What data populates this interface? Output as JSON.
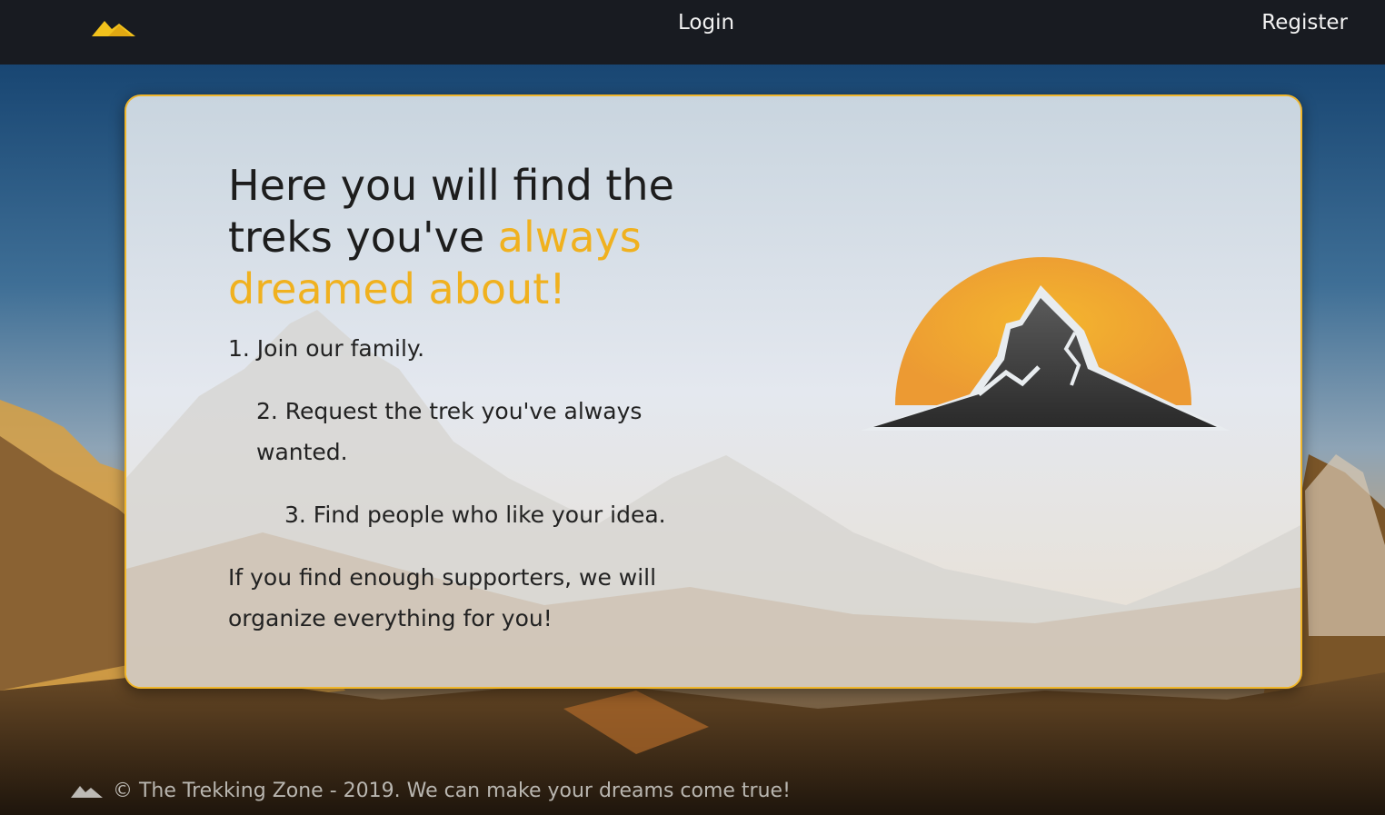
{
  "nav": {
    "logo_icon": "mountain-logo-icon",
    "login_label": "Login",
    "register_label": "Register"
  },
  "hero": {
    "headline_part1": "Here you will find the treks you've ",
    "headline_accent": "always dreamed about!",
    "steps": [
      "1. Join our family.",
      "2. Request the trek you've always wanted.",
      "3. Find people who like your idea."
    ],
    "closing": "If you find enough supporters, we will organize everything for you!",
    "illustration_icon": "sun-mountain-icon"
  },
  "footer": {
    "logo_icon": "mountain-logo-icon",
    "text": "© The Trekking Zone - 2019. We can make your dreams come true!"
  },
  "colors": {
    "accent": "#f0b11f",
    "navbar": "#181b21",
    "card_border": "#f0b62a"
  }
}
